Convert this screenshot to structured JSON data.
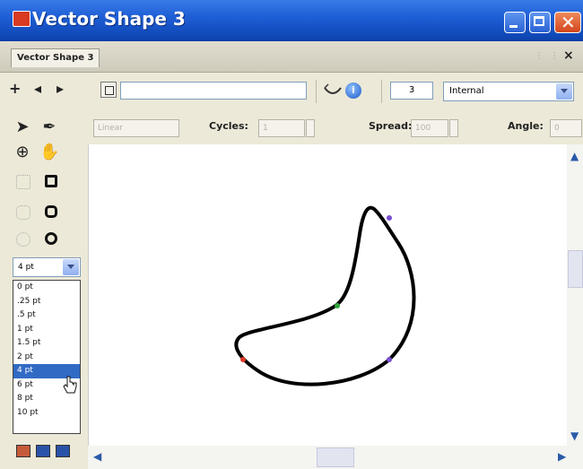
{
  "window": {
    "title": "Vector Shape 3",
    "tab_label": "Vector Shape 3",
    "tab_close": "×"
  },
  "toolbar": {
    "nav": [
      "+",
      "◂",
      "▸"
    ],
    "name_value": "",
    "count_value": "3",
    "render_mode": "Internal",
    "info_glyph": "i"
  },
  "properties": {
    "disabled_select": "Linear",
    "cycles_label": "Cycles:",
    "cycles_value": "1",
    "spread_label": "Spread:",
    "spread_value": "100",
    "angle_label": "Angle:",
    "angle_value": "0"
  },
  "toolbox": {
    "stroke_size_selected": "4 pt",
    "stroke_sizes": [
      "0 pt",
      ".25 pt",
      ".5 pt",
      "1 pt",
      "1.5 pt",
      "2 pt",
      "4 pt",
      "6 pt",
      "8 pt",
      "10 pt"
    ],
    "highlighted_size": "4 pt"
  },
  "colors": {
    "title_blue": "#1f5fd6",
    "selection_blue": "#316ac5",
    "path_stroke": "#000000",
    "point_green": "#2fa83a",
    "point_red": "#e03a2a",
    "point_purple": "#7a4fd0"
  }
}
